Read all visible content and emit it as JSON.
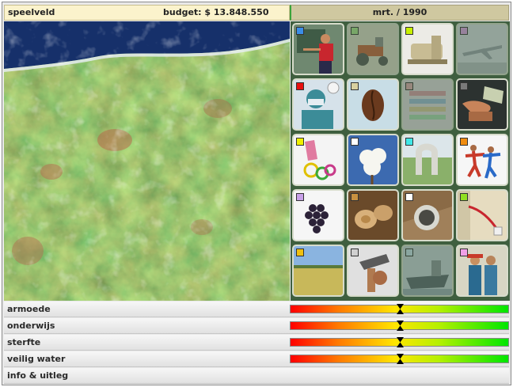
{
  "header": {
    "title": "speelveld",
    "budget": "budget: $ 13.848.550",
    "date": "mrt. / 1990"
  },
  "tiles": [
    {
      "name": "education",
      "color": "#3b8ee8",
      "dim": false
    },
    {
      "name": "tractor",
      "color": "#a8e08a",
      "dim": true
    },
    {
      "name": "sewing-machine",
      "color": "#c8f000",
      "dim": false
    },
    {
      "name": "airplane",
      "color": "#e0a0e8",
      "dim": true
    },
    {
      "name": "health-worker",
      "color": "#e81010",
      "dim": false
    },
    {
      "name": "coffee-bean",
      "color": "#d8d0a0",
      "dim": false
    },
    {
      "name": "textiles",
      "color": "#e0a8b0",
      "dim": true
    },
    {
      "name": "money-handshake",
      "color": "#7a7a7a",
      "dim": false
    },
    {
      "name": "condoms",
      "color": "#f0f000",
      "dim": false
    },
    {
      "name": "cotton",
      "color": "#ffffff",
      "dim": false
    },
    {
      "name": "water-pipes",
      "color": "#40e8e8",
      "dim": false
    },
    {
      "name": "dancers",
      "color": "#f08c10",
      "dim": false
    },
    {
      "name": "grapes",
      "color": "#c8a0e8",
      "dim": false
    },
    {
      "name": "timber",
      "color": "#c89040",
      "dim": false
    },
    {
      "name": "sewer-pipe",
      "color": "#ffffff",
      "dim": false
    },
    {
      "name": "electricity",
      "color": "#90e020",
      "dim": false
    },
    {
      "name": "wheat-field",
      "color": "#f0c010",
      "dim": false
    },
    {
      "name": "hammer-tool",
      "color": "#d0d0d0",
      "dim": false
    },
    {
      "name": "cargo-ship",
      "color": "#c8e0f0",
      "dim": true
    },
    {
      "name": "women-workers",
      "color": "#f0a0e8",
      "dim": false
    }
  ],
  "indicators": [
    {
      "label": "armoede",
      "level": 0.5
    },
    {
      "label": "onderwijs",
      "level": 0.5
    },
    {
      "label": "sterfte",
      "level": 0.5
    },
    {
      "label": "veilig water",
      "level": 0.5
    }
  ],
  "footer": {
    "info_label": "info & uitleg"
  }
}
